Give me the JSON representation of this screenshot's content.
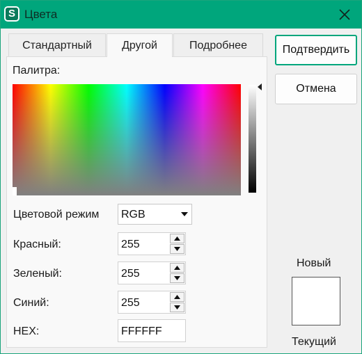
{
  "window": {
    "title": "Цвета",
    "app_icon_letter": "S"
  },
  "tabs": [
    {
      "label": "Стандартный",
      "active": false
    },
    {
      "label": "Другой",
      "active": true
    },
    {
      "label": "Подробнее",
      "active": false
    }
  ],
  "palette": {
    "label": "Палитра:"
  },
  "color_mode": {
    "label": "Цветовой режим",
    "value": "RGB"
  },
  "fields": {
    "red": {
      "label": "Красный:",
      "value": "255"
    },
    "green": {
      "label": "Зеленый:",
      "value": "255"
    },
    "blue": {
      "label": "Синий:",
      "value": "255"
    },
    "hex": {
      "label": "HEX:",
      "value": "FFFFFF"
    }
  },
  "buttons": {
    "confirm": "Подтвердить",
    "cancel": "Отмена"
  },
  "preview": {
    "new_label": "Новый",
    "current_label": "Текущий",
    "color": "#ffffff"
  },
  "colors": {
    "accent": "#00a67c",
    "window_bg": "#f0f0f0"
  }
}
